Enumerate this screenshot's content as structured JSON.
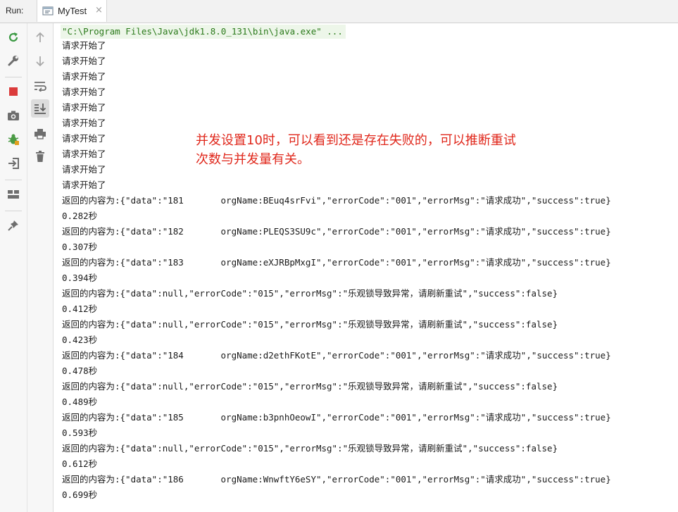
{
  "toolbar": {
    "run_label": "Run:",
    "tab_title": "MyTest",
    "tab_close": "×"
  },
  "left_tools": [
    {
      "name": "rerun-icon"
    },
    {
      "name": "wrench-icon"
    },
    {
      "name": "stop-icon"
    },
    {
      "name": "camera-icon"
    },
    {
      "name": "debug-bug-icon"
    },
    {
      "name": "login-icon"
    },
    {
      "name": "layout-icon"
    },
    {
      "name": "pin-icon"
    }
  ],
  "console_tools": [
    {
      "name": "up-arrow-icon"
    },
    {
      "name": "down-arrow-icon"
    },
    {
      "name": "soft-wrap-icon"
    },
    {
      "name": "scroll-to-end-icon"
    },
    {
      "name": "print-icon"
    },
    {
      "name": "trash-icon"
    }
  ],
  "console": {
    "command": "\"C:\\Program Files\\Java\\jdk1.8.0_131\\bin\\java.exe\" ...",
    "lines": [
      "请求开始了",
      "请求开始了",
      "请求开始了",
      "请求开始了",
      "请求开始了",
      "请求开始了",
      "请求开始了",
      "请求开始了",
      "请求开始了",
      "请求开始了",
      "返回的内容为:{\"data\":\"181       orgName:BEuq4srFvi\",\"errorCode\":\"001\",\"errorMsg\":\"请求成功\",\"success\":true}",
      "0.282秒",
      "返回的内容为:{\"data\":\"182       orgName:PLEQS3SU9c\",\"errorCode\":\"001\",\"errorMsg\":\"请求成功\",\"success\":true}",
      "0.307秒",
      "返回的内容为:{\"data\":\"183       orgName:eXJRBpMxgI\",\"errorCode\":\"001\",\"errorMsg\":\"请求成功\",\"success\":true}",
      "0.394秒",
      "返回的内容为:{\"data\":null,\"errorCode\":\"015\",\"errorMsg\":\"乐观锁导致异常，请刷新重试\",\"success\":false}",
      "0.412秒",
      "返回的内容为:{\"data\":null,\"errorCode\":\"015\",\"errorMsg\":\"乐观锁导致异常，请刷新重试\",\"success\":false}",
      "0.423秒",
      "返回的内容为:{\"data\":\"184       orgName:d2ethFKotE\",\"errorCode\":\"001\",\"errorMsg\":\"请求成功\",\"success\":true}",
      "0.478秒",
      "返回的内容为:{\"data\":null,\"errorCode\":\"015\",\"errorMsg\":\"乐观锁导致异常，请刷新重试\",\"success\":false}",
      "0.489秒",
      "返回的内容为:{\"data\":\"185       orgName:b3pnhOeowI\",\"errorCode\":\"001\",\"errorMsg\":\"请求成功\",\"success\":true}",
      "0.593秒",
      "返回的内容为:{\"data\":null,\"errorCode\":\"015\",\"errorMsg\":\"乐观锁导致异常，请刷新重试\",\"success\":false}",
      "0.612秒",
      "返回的内容为:{\"data\":\"186       orgName:WnwftY6eSY\",\"errorCode\":\"001\",\"errorMsg\":\"请求成功\",\"success\":true}",
      "0.699秒"
    ]
  },
  "annotation": "并发设置10时，可以看到还是存在失败的，可以推断重试\n次数与并发量有关。",
  "colors": {
    "command_green": "#2b7a1b",
    "annotation_red": "#e0281c",
    "stop_red": "#db3b3b",
    "rerun_green": "#3c9a44"
  }
}
